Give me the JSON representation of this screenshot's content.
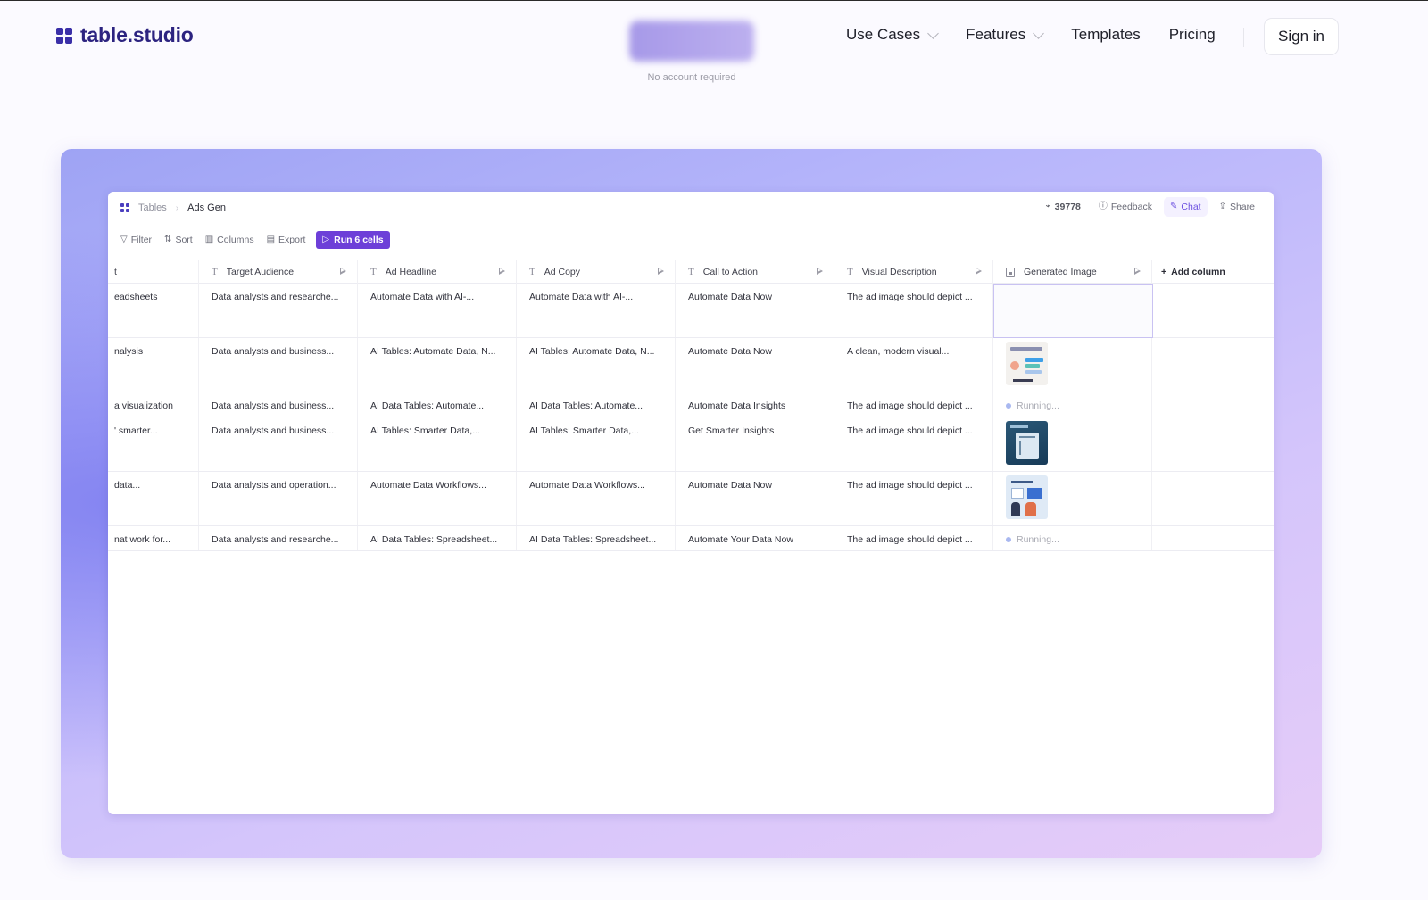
{
  "nav": {
    "logo_text": "table.studio",
    "cta_note": "No account required",
    "links": [
      {
        "label": "Use Cases",
        "dropdown": true
      },
      {
        "label": "Features",
        "dropdown": true
      },
      {
        "label": "Templates",
        "dropdown": false
      },
      {
        "label": "Pricing",
        "dropdown": false
      }
    ],
    "signin": "Sign in"
  },
  "app": {
    "breadcrumb": {
      "root": "Tables",
      "current": "Ads Gen"
    },
    "header": {
      "count": "39778",
      "feedback": "Feedback",
      "chat": "Chat",
      "share": "Share"
    },
    "toolbar": {
      "filter": "Filter",
      "sort": "Sort",
      "columns": "Columns",
      "export": "Export",
      "run": "Run 6 cells"
    },
    "table": {
      "columns": [
        {
          "label": "t",
          "icon": "none"
        },
        {
          "label": "Target Audience",
          "icon": "text-type-icon"
        },
        {
          "label": "Ad Headline",
          "icon": "text-type-icon"
        },
        {
          "label": "Ad Copy",
          "icon": "text-type-icon"
        },
        {
          "label": "Call to Action",
          "icon": "text-type-icon"
        },
        {
          "label": "Visual Description",
          "icon": "text-type-icon"
        },
        {
          "label": "Generated Image",
          "icon": "image-type-icon"
        }
      ],
      "add_column": "Add column",
      "rows": [
        {
          "c0": "eadsheets",
          "c1": "Data analysts and researche...",
          "c2": "Automate Data with AI-...",
          "c3": "Automate Data with AI-...",
          "c4": "Automate Data Now",
          "c5": "The ad image should depict ...",
          "image": "empty-selected"
        },
        {
          "c0": "nalysis",
          "c1": "Data analysts and business...",
          "c2": "AI Tables: Automate Data, N...",
          "c3": "AI Tables: Automate Data, N...",
          "c4": "Automate Data Now",
          "c5": "A clean, modern visual...",
          "image": "thumbnail"
        },
        {
          "c0": "a visualization",
          "c1": "Data analysts and business...",
          "c2": "AI Data Tables: Automate...",
          "c3": "AI Data Tables: Automate...",
          "c4": "Automate Data Insights",
          "c5": "The ad image should depict ...",
          "image": "running",
          "image_text": "Running..."
        },
        {
          "c0": "' smarter...",
          "c1": "Data analysts and business...",
          "c2": "AI Tables: Smarter Data,...",
          "c3": "AI Tables: Smarter Data,...",
          "c4": "Get Smarter Insights",
          "c5": "The ad image should depict ...",
          "image": "thumbnail"
        },
        {
          "c0": "data...",
          "c1": "Data analysts and operation...",
          "c2": "Automate Data Workflows...",
          "c3": "Automate Data Workflows...",
          "c4": "Automate Data Now",
          "c5": "The ad image should depict ...",
          "image": "thumbnail"
        },
        {
          "c0": "nat work for...",
          "c1": "Data analysts and researche...",
          "c2": "AI Data Tables: Spreadsheet...",
          "c3": "AI Data Tables: Spreadsheet...",
          "c4": "Automate Your Data Now",
          "c5": "The ad image should depict ...",
          "image": "running",
          "image_text": "Running..."
        }
      ]
    }
  },
  "colors": {
    "brand": "#2c2380",
    "accent": "#6d3fd8",
    "running_dot": "#a9b8f0"
  }
}
